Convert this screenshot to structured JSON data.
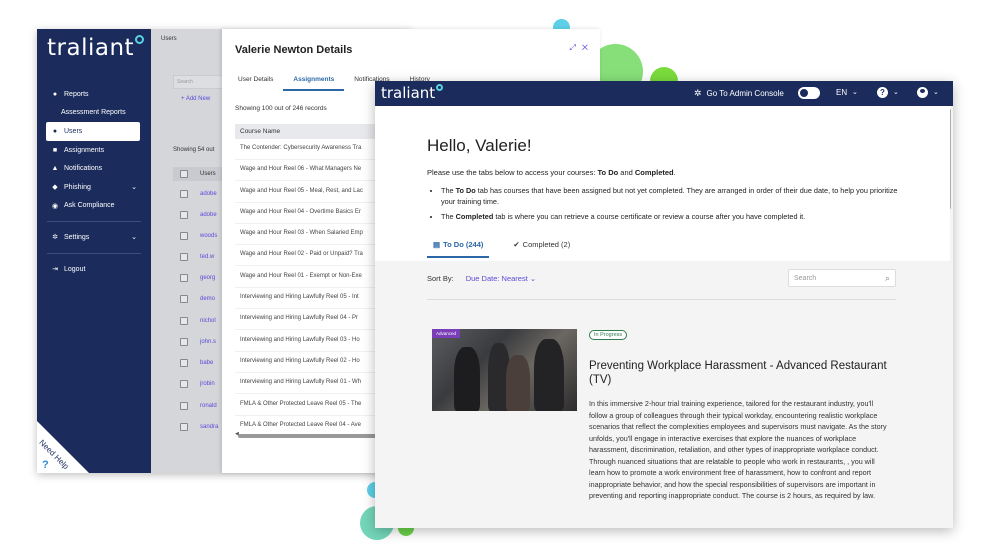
{
  "admin": {
    "logo": "traliant",
    "breadcrumb": "Users",
    "nav": [
      {
        "label": "Reports",
        "icon": "info-icon"
      },
      {
        "label": "Assessment Reports",
        "icon": ""
      },
      {
        "label": "Users",
        "icon": "user-icon"
      },
      {
        "label": "Assignments",
        "icon": "assignments-icon"
      },
      {
        "label": "Notifications",
        "icon": "bell-icon"
      },
      {
        "label": "Phishing",
        "icon": "fish-icon"
      },
      {
        "label": "Ask Compliance",
        "icon": "handshake-icon"
      },
      {
        "label": "Settings",
        "icon": "gear-icon"
      },
      {
        "label": "Logout",
        "icon": "logout-icon"
      }
    ],
    "search_placeholder": "Search",
    "add_new": "+ Add New",
    "showing": "Showing 54 out",
    "table_header": "Users",
    "rows": [
      "adobe",
      "adobe",
      "woods",
      "ted.w",
      "georg",
      "demo",
      "nichol",
      "john.s",
      "babe",
      "jrobin",
      "ronald",
      "sandra"
    ],
    "help_label": "Need Help",
    "help_icon": "?"
  },
  "details": {
    "title": "Valerie Newton Details",
    "tabs": [
      "User Details",
      "Assignments",
      "Notifications",
      "History"
    ],
    "records": "Showing 100 out of 246 records",
    "column": "Course Name",
    "courses": [
      "The Contender: Cybersecurity Awareness Tra",
      "Wage and Hour Reel 06 - What Managers Ne",
      "Wage and Hour Reel 05 - Meal, Rest, and Lac",
      "Wage and Hour Reel 04 - Overtime Basics Er",
      "Wage and Hour Reel 03 - When Salaried Emp",
      "Wage and Hour Reel 02 - Paid or Unpaid? Tra",
      "Wage and Hour Reel 01 - Exempt or Non-Exe",
      "Interviewing and Hiring Lawfully Reel 05 - Int",
      "Interviewing and Hiring Lawfully Reel 04 - Pr",
      "Interviewing and Hiring Lawfully Reel 03 - Ho",
      "Interviewing and Hiring Lawfully Reel 02 - Ho",
      "Interviewing and Hiring Lawfully Reel 01 - Wh",
      "FMLA & Other Protected Leave Reel 05 - The",
      "FMLA & Other Protected Leave Reel 04 - Ave"
    ]
  },
  "learner": {
    "logo": "traliant",
    "admin_console": "Go To Admin Console",
    "language": "EN",
    "help_icon": "?",
    "greeting": "Hello, Valerie!",
    "intro_prefix": "Please use the tabs below to access your courses: ",
    "intro_todo": "To Do",
    "intro_and": " and ",
    "intro_completed": "Completed",
    "intro_end": ".",
    "bullet1_prefix": "The ",
    "bullet1_bold": "To Do",
    "bullet1_text": " tab has courses that have been assigned but not yet completed. They are arranged in order of their due date, to help you prioritize your training time.",
    "bullet2_prefix": "The ",
    "bullet2_bold": "Completed",
    "bullet2_text": " tab is where you can retrieve a course certificate or review a course after you have completed it.",
    "tab_todo": "To Do (244)",
    "tab_completed": "Completed (2)",
    "sort_label": "Sort By:",
    "sort_value": "Due Date: Nearest",
    "search_placeholder": "Search",
    "course": {
      "badge": "Advanced",
      "status": "In Progress",
      "title": "Preventing Workplace Harassment - Advanced Restaurant (TV)",
      "description": "In this immersive 2-hour trial training experience, tailored for the restaurant industry, you'll follow a group of colleagues through their typical workday, encountering realistic workplace scenarios that reflect the complexities employees and supervisors must navigate. As the story unfolds, you'll engage in interactive exercises that explore the nuances of workplace harassment, discrimination, retaliation, and other types of inappropriate workplace conduct. Through nuanced situations that are relatable to people who work in restaurants, , you will learn how to promote a work environment free of harassment, how to confront and report inappropriate behavior, and how the special responsibilities of supervisors are important in preventing and reporting inappropriate conduct. The course is 2 hours, as required by law."
    }
  },
  "colors": {
    "navy": "#1b2c5c",
    "accent_blue": "#2c68a8",
    "link_purple": "#5b4bd8",
    "green": "#5ed44c",
    "cyan": "#45c8dc"
  }
}
